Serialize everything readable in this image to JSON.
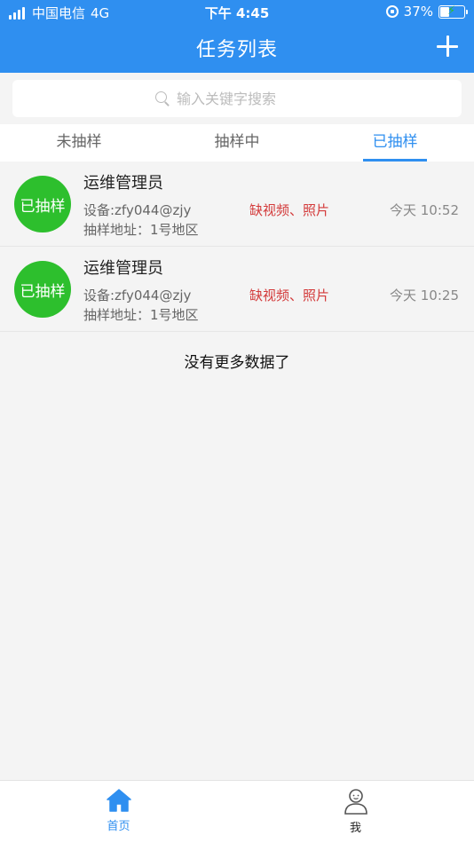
{
  "status_bar": {
    "carrier": "中国电信",
    "network": "4G",
    "time": "下午 4:45",
    "battery": "37%",
    "battery_level": 0.37
  },
  "header": {
    "title": "任务列表",
    "add_icon": "plus-icon"
  },
  "search": {
    "placeholder": "输入关键字搜索",
    "value": ""
  },
  "tabs": [
    {
      "label": "未抽样",
      "active": false
    },
    {
      "label": "抽样中",
      "active": false
    },
    {
      "label": "已抽样",
      "active": true
    }
  ],
  "tasks": [
    {
      "badge": "已抽样",
      "title": "运维管理员",
      "device": "设备:zfy044@zjy",
      "missing": "缺视频、照片",
      "time": "今天 10:52",
      "address": "抽样地址：1号地区"
    },
    {
      "badge": "已抽样",
      "title": "运维管理员",
      "device": "设备:zfy044@zjy",
      "missing": "缺视频、照片",
      "time": "今天 10:25",
      "address": "抽样地址：1号地区"
    }
  ],
  "list_footer": "没有更多数据了",
  "bottom_nav": [
    {
      "label": "首页",
      "icon": "home-icon",
      "active": true
    },
    {
      "label": "我",
      "icon": "user-icon",
      "active": false
    }
  ],
  "colors": {
    "primary": "#2f8ff0",
    "badge_green": "#2dbf2d",
    "missing_red": "#d33a3a"
  }
}
